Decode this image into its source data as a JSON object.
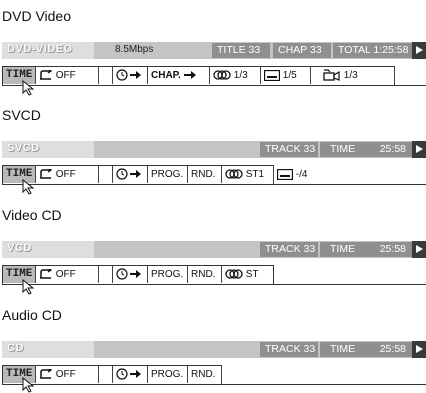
{
  "sections": [
    {
      "title": "DVD Video",
      "disc_label": "DVD-VIDEO",
      "bitrate": "8.5Mbps",
      "title_box": "TITLE 33",
      "chap_box": "CHAP 33",
      "total_box": "TOTAL 1:25:58",
      "menu": {
        "time": "TIME",
        "repeat": "OFF",
        "chap_search": "CHAP.",
        "audio": "1/3",
        "subtitle": "1/5",
        "angle": "1/3"
      }
    },
    {
      "title": "SVCD",
      "disc_label": "SVCD",
      "track_box": "TRACK 33",
      "time_label": "TIME",
      "time_value": "25:58",
      "menu": {
        "time": "TIME",
        "repeat": "OFF",
        "prog": "PROG.",
        "rnd": "RND.",
        "audio": "ST1",
        "subtitle": "-/4"
      }
    },
    {
      "title": "Video CD",
      "disc_label": "VCD",
      "track_box": "TRACK 33",
      "time_label": "TIME",
      "time_value": "25:58",
      "menu": {
        "time": "TIME",
        "repeat": "OFF",
        "prog": "PROG.",
        "rnd": "RND.",
        "audio": "ST"
      }
    },
    {
      "title": "Audio CD",
      "disc_label": "CD",
      "track_box": "TRACK 33",
      "time_label": "TIME",
      "time_value": "25:58",
      "menu": {
        "time": "TIME",
        "repeat": "OFF",
        "prog": "PROG.",
        "rnd": "RND."
      }
    }
  ],
  "icons": {
    "repeat": "repeat-icon",
    "time_search": "clock-arrow-icon",
    "audio": "audio-channel-icon",
    "subtitle": "subtitle-icon",
    "angle": "camera-angle-icon",
    "play": "play-icon",
    "cursor": "pointer-cursor-icon"
  }
}
